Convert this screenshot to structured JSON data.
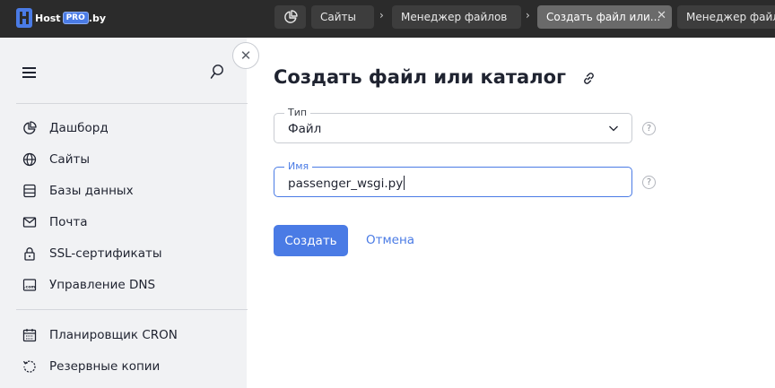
{
  "logo": {
    "host": "Host",
    "pro": "PRO",
    "by": ".by"
  },
  "tabs": [
    {
      "label": "Сайты",
      "active": false
    },
    {
      "label": "Менеджер файлов",
      "active": false
    },
    {
      "label": "Создать файл или...",
      "active": true,
      "closable": true
    },
    {
      "label": "Менеджер файло",
      "active": false
    }
  ],
  "sidebar": {
    "items": [
      {
        "label": "Дашборд",
        "icon": "pie-chart-icon"
      },
      {
        "label": "Сайты",
        "icon": "globe-icon"
      },
      {
        "label": "Базы данных",
        "icon": "database-icon"
      },
      {
        "label": "Почта",
        "icon": "mail-icon"
      },
      {
        "label": "SSL-сертификаты",
        "icon": "lock-icon"
      },
      {
        "label": "Управление DNS",
        "icon": "dns-icon"
      },
      {
        "label": "Планировщик CRON",
        "icon": "calendar-icon"
      },
      {
        "label": "Резервные копии",
        "icon": "backup-icon"
      }
    ],
    "dns_icon_text": ".com"
  },
  "main": {
    "title": "Создать файл или каталог",
    "type_field": {
      "label": "Тип",
      "value": "Файл"
    },
    "name_field": {
      "label": "Имя",
      "value": "passenger_wsgi.py"
    },
    "help": "?",
    "submit_label": "Создать",
    "cancel_label": "Отмена"
  },
  "colors": {
    "accent": "#4a7be5",
    "topbar": "#2b2b2b",
    "sidebar": "#f1f2f4"
  }
}
